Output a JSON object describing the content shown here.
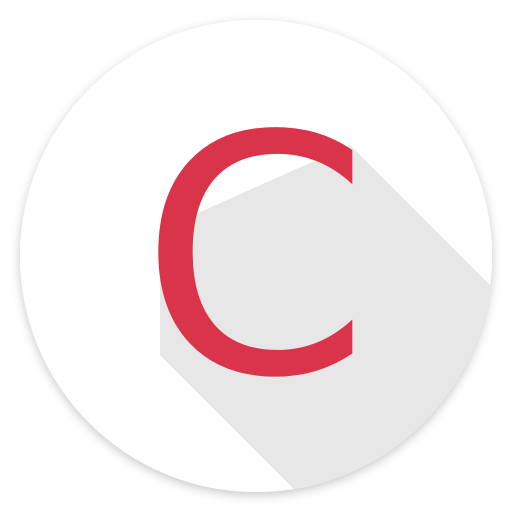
{
  "icon": {
    "letter": "C",
    "name": "c-letter-icon",
    "colors": {
      "background": "#ffffff",
      "badge": "#ffffff",
      "badge_edge": "#d9d9d9",
      "long_shadow": "#e6e6e6",
      "letter": "#d9344a"
    }
  }
}
